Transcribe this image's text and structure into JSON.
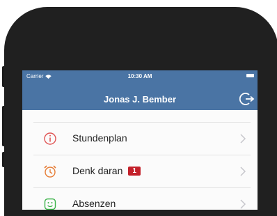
{
  "status_bar": {
    "carrier": "Carrier",
    "time": "10:30 AM"
  },
  "header": {
    "title": "Jonas J. Bember",
    "logout_icon": "logout-icon"
  },
  "menu": [
    {
      "label": "Stundenplan",
      "icon": "info-circle-icon",
      "icon_color": "#e05555"
    },
    {
      "label": "Denk daran",
      "icon": "alarm-clock-icon",
      "icon_color": "#e67c35",
      "badge": "1"
    },
    {
      "label": "Absenzen",
      "icon": "smiley-icon",
      "icon_color": "#3cb34a"
    }
  ],
  "colors": {
    "header": "#4a74a4",
    "badge": "#c3212a"
  }
}
